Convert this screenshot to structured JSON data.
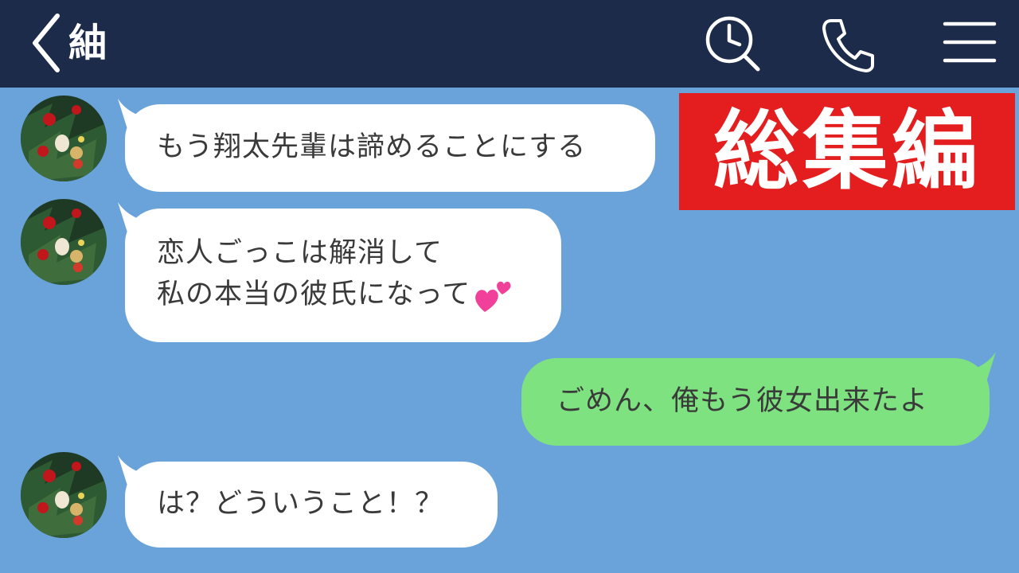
{
  "header": {
    "title": "紬",
    "back_icon": "chevron-left-icon",
    "search_icon": "clock-search-icon",
    "call_icon": "phone-icon",
    "menu_icon": "hamburger-menu-icon",
    "background_color": "#1d2b4a"
  },
  "banner": {
    "text": "総集編",
    "color": "#e41e1e"
  },
  "messages": [
    {
      "sender": "other",
      "lines": [
        "もう翔太先輩は諦めることにする"
      ]
    },
    {
      "sender": "other",
      "lines": [
        "恋人ごっこは解消して",
        "私の本当の彼氏になって"
      ],
      "emoji": "two-hearts-icon"
    },
    {
      "sender": "self",
      "lines": [
        "ごめん、俺もう彼女出来たよ"
      ]
    },
    {
      "sender": "other",
      "lines": [
        "は？どういうこと！？"
      ]
    }
  ],
  "colors": {
    "chat_background": "#6aa3d9",
    "incoming_bubble": "#ffffff",
    "outgoing_bubble": "#7de27f"
  }
}
